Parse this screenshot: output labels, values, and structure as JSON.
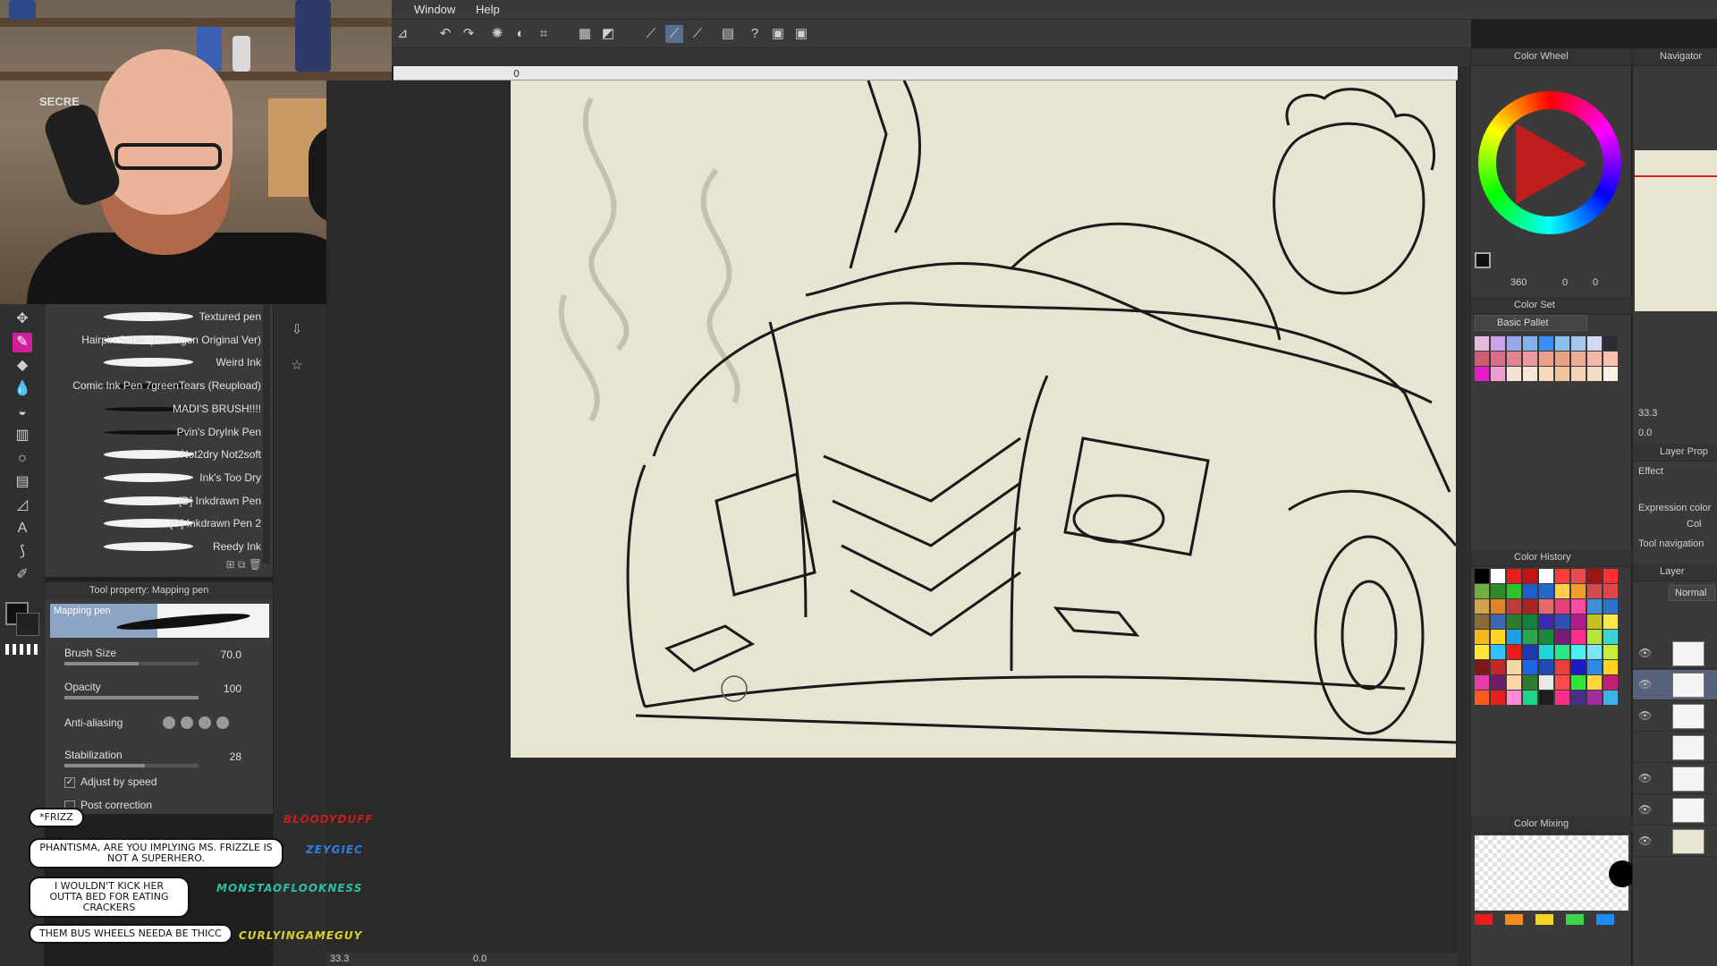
{
  "menubar": {
    "items": [
      "Window",
      "Help"
    ]
  },
  "webcam": {
    "logo_text": "SECRE"
  },
  "ruler": {
    "origin_label": "0"
  },
  "brushes": [
    {
      "name": "Textured pen",
      "style": "light"
    },
    {
      "name": "Hairpin Sable (Pentagon Original Ver)",
      "style": "light"
    },
    {
      "name": "Weird Ink",
      "style": "light"
    },
    {
      "name": "Comic Ink Pen 7greenTears (Reupload)",
      "style": "dark"
    },
    {
      "name": "MADI'S BRUSH!!!!",
      "style": "dark"
    },
    {
      "name": "Pvin's DryInk Pen",
      "style": "dark"
    },
    {
      "name": "Not2dry Not2soft",
      "style": "light"
    },
    {
      "name": "Ink's Too Dry",
      "style": "light"
    },
    {
      "name": "[D] Inkdrawn Pen",
      "style": "light"
    },
    {
      "name": "[D] Inkdrawn Pen 2",
      "style": "light"
    },
    {
      "name": "Reedy Ink",
      "style": "light"
    }
  ],
  "tool_property": {
    "header": "Tool property: Mapping pen",
    "preview_label": "Mapping pen",
    "brush_size_label": "Brush Size",
    "brush_size_value": "70.0",
    "brush_size_level": 0.55,
    "opacity_label": "Opacity",
    "opacity_value": "100",
    "opacity_level": 1.0,
    "antialias_label": "Anti-aliasing",
    "stabilization_label": "Stabilization",
    "stabilization_value": "28",
    "stabilization_level": 0.6,
    "adjust_label": "Adjust by speed",
    "post_label": "Post correction"
  },
  "chat": [
    {
      "message": "*FRIZZ",
      "user": "BLOODYDUFF",
      "color": "#c41e1e"
    },
    {
      "message": "PHANTISMA, ARE YOU IMPLYING MS. FRIZZLE IS NOT A SUPERHERO.",
      "user": "ZEYGIEC",
      "color": "#2f7fe0"
    },
    {
      "message": "I WOULDN'T KICK HER OUTTA BED FOR EATING CRACKERS",
      "user": "MONSTAOFLOOKNESS",
      "color": "#29c1a2"
    },
    {
      "message": "THEM BUS WHEELS NEEDA BE THICC",
      "user": "CURLYINGAMEGUY",
      "color": "#d7d12a"
    }
  ],
  "status": {
    "zoom": "33.3",
    "angle": "0.0"
  },
  "color_wheel": {
    "title": "Color Wheel",
    "readout": "360",
    "v1": "0",
    "v2": "0"
  },
  "color_set": {
    "title": "Color Set",
    "palette": "Basic Pallet",
    "colors": [
      "#e7b9de",
      "#c9a3e6",
      "#9aa6ea",
      "#7fb3f2",
      "#3a8ef5",
      "#8cc0ef",
      "#a5c6f0",
      "#d4d9f2",
      "#2c2c36",
      "#cf5d72",
      "#d86e85",
      "#e0848e",
      "#ea9a9a",
      "#f0a08a",
      "#e7a284",
      "#ecae92",
      "#f2b8a7",
      "#f7c2b2",
      "#e21cc6",
      "#ee9fd0",
      "#f2e4d5",
      "#f7e8d6",
      "#f6d9b8",
      "#f1c4a0",
      "#f5d3b7",
      "#f3dec7",
      "#faf0e4"
    ]
  },
  "color_history": {
    "title": "Color History",
    "colors": [
      "#000000",
      "#ffffff",
      "#e81e1e",
      "#c41313",
      "#ffffff",
      "#ff3b3b",
      "#e84b4b",
      "#a01414",
      "#ff3030",
      "#6fb140",
      "#2c8c2c",
      "#28c428",
      "#1f5ec8",
      "#2466c9",
      "#ffd04a",
      "#f29b2e",
      "#d14d4d",
      "#e1474a",
      "#d3a24a",
      "#e0842a",
      "#c23a3a",
      "#a82323",
      "#e66a6a",
      "#e83e7a",
      "#ff4aa6",
      "#3e8fd6",
      "#2c73d0",
      "#8a6a3a",
      "#3f66b3",
      "#2e7a2e",
      "#13813e",
      "#3a2ab3",
      "#2e4fb5",
      "#b31c8f",
      "#c2c21e",
      "#ffe64a",
      "#f5b61e",
      "#ffd61e",
      "#1fa0e6",
      "#29a54a",
      "#1a8a3a",
      "#7a1a7a",
      "#ff2e8a",
      "#b4e63a",
      "#3ad6d6",
      "#ffe63a",
      "#2ec2ff",
      "#e81e1e",
      "#1e3ab3",
      "#1ed6d6",
      "#2ee68a",
      "#4af0f0",
      "#7ae6f5",
      "#c4f03a",
      "#7a1a1a",
      "#c22828",
      "#f5d8a5",
      "#1e64e6",
      "#1e4ab3",
      "#e83e3e",
      "#1a1ac4",
      "#2e8ae6",
      "#ffd31e",
      "#e63ea8",
      "#6a1e6a",
      "#ffd6a8",
      "#2e7a2e",
      "#e8e8e8",
      "#ff4a4a",
      "#2ee63a",
      "#ffd63a",
      "#c41e7a",
      "#ff5a1e",
      "#e61e1e",
      "#ff8ad6",
      "#1ed68a",
      "#1e1e1e",
      "#ff2e8a",
      "#4a2e8a",
      "#a02ea0",
      "#3ab3e6"
    ]
  },
  "color_mixing": {
    "title": "Color Mixing",
    "bar_colors": [
      "#e81e1e",
      "#f28c1e",
      "#f5d31e",
      "#3ad64a",
      "#1e8af5"
    ]
  },
  "navigator": {
    "title": "Navigator",
    "zoom": "33.3",
    "angle": "0.0"
  },
  "layer_property": {
    "title": "Layer Prop",
    "effect": "Effect",
    "expression": "Expression color",
    "expression_value": "Col"
  },
  "tool_navigation": {
    "title": "Tool navigation"
  },
  "layer": {
    "title": "Layer",
    "blend": "Normal"
  }
}
